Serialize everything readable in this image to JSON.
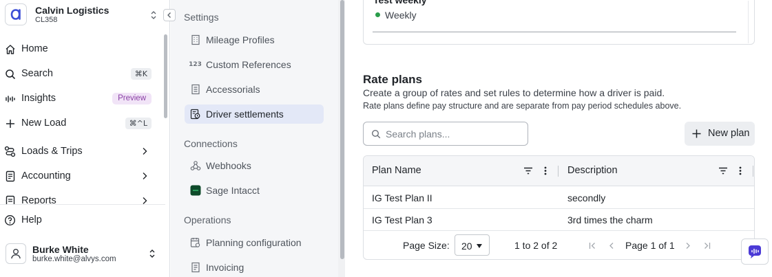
{
  "org": {
    "name": "Calvin Logistics",
    "code": "CL358"
  },
  "nav": {
    "home": "Home",
    "search": "Search",
    "search_shortcut": "⌘K",
    "insights": "Insights",
    "insights_badge": "Preview",
    "new_load": "New Load",
    "new_load_shortcut": "⌘^L",
    "loads_trips": "Loads & Trips",
    "accounting": "Accounting",
    "reports": "Reports",
    "help": "Help"
  },
  "user": {
    "name": "Burke White",
    "email": "burke.white@alvys.com"
  },
  "settings_nav": {
    "settings_title": "Settings",
    "items": [
      "Mileage Profiles",
      "Custom References",
      "Accessorials",
      "Driver settlements"
    ],
    "active": "Driver settlements",
    "custom_refs_icon_text": "123",
    "connections_title": "Connections",
    "connections": [
      "Webhooks",
      "Sage Intacct"
    ],
    "operations_title": "Operations",
    "operations": [
      "Planning configuration",
      "Invoicing"
    ]
  },
  "pay_period_card": {
    "title": "Test weekly",
    "status": "Weekly",
    "status_color": "#2a9d4a"
  },
  "rate_plans": {
    "title": "Rate plans",
    "subtitle": "Create a group of rates and set rules to determine how a driver is paid.",
    "note": "Rate plans define pay structure and are separate from pay period schedules above.",
    "search_placeholder": "Search plans...",
    "new_plan_label": "New plan",
    "columns": [
      "Plan Name",
      "Description"
    ],
    "rows": [
      {
        "name": "IG Test Plan II",
        "description": "secondly"
      },
      {
        "name": "IG Test Plan 3",
        "description": "3rd times the charm"
      }
    ],
    "pager": {
      "page_size_label": "Page Size:",
      "page_size": "20",
      "range": "1 to 2 of 2",
      "page_label": "Page 1 of 1"
    }
  },
  "colors": {
    "brand": "#3d4fd6",
    "active_bg": "#e3e8f7",
    "preview_badge": "#8a3ea5"
  }
}
